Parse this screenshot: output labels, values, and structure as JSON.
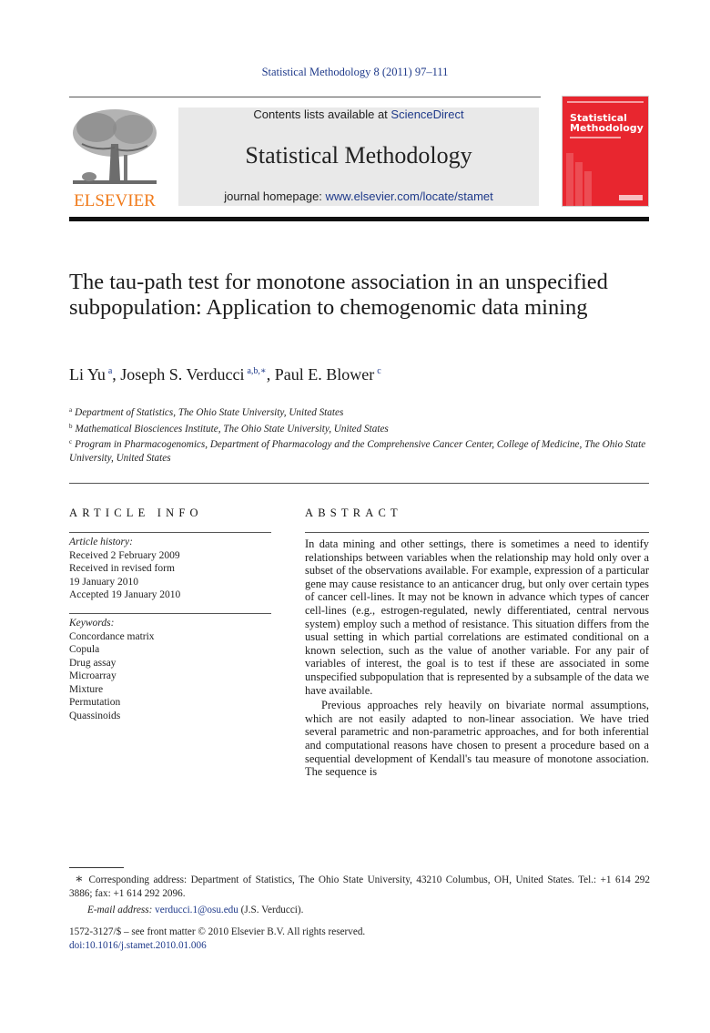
{
  "header": {
    "citation": "Statistical Methodology 8 (2011) 97–111",
    "contents_prefix": "Contents lists available at ",
    "contents_link": "ScienceDirect",
    "journal_title": "Statistical Methodology",
    "homepage_prefix": "journal homepage: ",
    "homepage_link": "www.elsevier.com/locate/stamet",
    "publisher_logo_text": "ELSEVIER",
    "cover_title_line1": "Statistical",
    "cover_title_line2": "Methodology"
  },
  "colors": {
    "link": "#1f3a8a",
    "elsevier_orange": "#f07a1a",
    "cover_red": "#e8262f",
    "banner_gray": "#e9e9e9"
  },
  "article": {
    "title": "The tau-path test for monotone association in an unspecified subpopulation: Application to chemogenomic data mining",
    "authors": [
      {
        "name": "Li Yu",
        "marks": "a"
      },
      {
        "name": "Joseph S. Verducci",
        "marks": "a,b,∗"
      },
      {
        "name": "Paul E. Blower",
        "marks": "c"
      }
    ],
    "affiliations": [
      {
        "mark": "a",
        "text": "Department of Statistics, The Ohio State University, United States"
      },
      {
        "mark": "b",
        "text": "Mathematical Biosciences Institute, The Ohio State University, United States"
      },
      {
        "mark": "c",
        "text": "Program in Pharmacogenomics, Department of Pharmacology and the Comprehensive Cancer Center, College of Medicine, The Ohio State University, United States"
      }
    ]
  },
  "article_info": {
    "heading": "ARTICLE INFO",
    "history_label": "Article history:",
    "history": [
      "Received 2 February 2009",
      "Received in revised form",
      "19 January 2010",
      "Accepted 19 January 2010"
    ],
    "keywords_label": "Keywords:",
    "keywords": [
      "Concordance matrix",
      "Copula",
      "Drug assay",
      "Microarray",
      "Mixture",
      "Permutation",
      "Quassinoids"
    ]
  },
  "abstract": {
    "heading": "ABSTRACT",
    "paragraphs": [
      "In data mining and other settings, there is sometimes a need to identify relationships between variables when the relationship may hold only over a subset of the observations available. For example, expression of a particular gene may cause resistance to an anticancer drug, but only over certain types of cancer cell-lines. It may not be known in advance which types of cancer cell-lines (e.g., estrogen-regulated, newly differentiated, central nervous system) employ such a method of resistance. This situation differs from the usual setting in which partial correlations are estimated conditional on a known selection, such as the value of another variable. For any pair of variables of interest, the goal is to test if these are associated in some unspecified subpopulation that is represented by a subsample of the data we have available.",
      "Previous approaches rely heavily on bivariate normal assumptions, which are not easily adapted to non-linear association. We have tried several parametric and non-parametric approaches, and for both inferential and computational reasons have chosen to present a procedure based on a sequential development of Kendall's tau measure of monotone association. The sequence is"
    ]
  },
  "footnotes": {
    "star": "∗",
    "corresponding": "Corresponding address: Department of Statistics, The Ohio State University, 43210 Columbus, OH, United States. Tel.: +1 614 292 3886; fax: +1 614 292 2096.",
    "email_label": "E-mail address: ",
    "email": "verducci.1@osu.edu",
    "email_suffix": " (J.S. Verducci).",
    "front_matter": "1572-3127/$ – see front matter © 2010 Elsevier B.V. All rights reserved.",
    "doi": "doi:10.1016/j.stamet.2010.01.006"
  }
}
